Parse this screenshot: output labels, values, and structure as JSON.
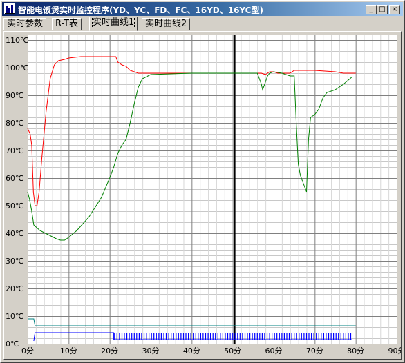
{
  "window": {
    "title": "智能电饭煲实时监控程序(YD、YC、FD、FC、16YD、16YC型)",
    "controls": {
      "minimize": "_",
      "maximize": "□",
      "close": "×"
    }
  },
  "tabs": [
    {
      "label": "实时参数",
      "active": false
    },
    {
      "label": "R-T表",
      "active": false
    },
    {
      "label": "实时曲线1",
      "active": true
    },
    {
      "label": "实时曲线2",
      "active": false
    }
  ],
  "chart_data": {
    "type": "line",
    "xlim": [
      0,
      90
    ],
    "ylim": [
      0,
      112
    ],
    "xticks": [
      0,
      10,
      20,
      30,
      40,
      50,
      60,
      70,
      80,
      90
    ],
    "xtick_labels": [
      "0分",
      "10分",
      "20分",
      "30分",
      "40分",
      "50分",
      "60分",
      "70分",
      "80分",
      "90分"
    ],
    "yticks": [
      0,
      10,
      20,
      30,
      40,
      50,
      60,
      70,
      80,
      90,
      100,
      110
    ],
    "ytick_labels": [
      "0℃",
      "10℃",
      "20℃",
      "30℃",
      "40℃",
      "50℃",
      "60℃",
      "70℃",
      "80℃",
      "90℃",
      "100℃",
      "110℃"
    ],
    "grid": true,
    "colors": {
      "red": "#ff0000",
      "green": "#008000",
      "teal": "#008080",
      "blue": "#0000ff",
      "marker": "#000000"
    },
    "marker_x": 50.5,
    "series": [
      {
        "color": "red",
        "points": [
          [
            0,
            78
          ],
          [
            0.6,
            76
          ],
          [
            1,
            72
          ],
          [
            1.4,
            55
          ],
          [
            1.8,
            50
          ],
          [
            2.3,
            50
          ],
          [
            2.8,
            55
          ],
          [
            3.5,
            68
          ],
          [
            4.5,
            84
          ],
          [
            5.5,
            96
          ],
          [
            6.5,
            101
          ],
          [
            7.5,
            102.5
          ],
          [
            9,
            103
          ],
          [
            10,
            103.5
          ],
          [
            13,
            104
          ],
          [
            18,
            104
          ],
          [
            21.5,
            104
          ],
          [
            22,
            102
          ],
          [
            23,
            101
          ],
          [
            24,
            100.5
          ],
          [
            25,
            99
          ],
          [
            27,
            98
          ],
          [
            30,
            98
          ],
          [
            40,
            98
          ],
          [
            50,
            98
          ],
          [
            57,
            98
          ],
          [
            58,
            97.5
          ],
          [
            59,
            98.5
          ],
          [
            60,
            98.5
          ],
          [
            61,
            98
          ],
          [
            64,
            98
          ],
          [
            65,
            99
          ],
          [
            70,
            99
          ],
          [
            75,
            98.5
          ],
          [
            77,
            98
          ],
          [
            80,
            98
          ]
        ]
      },
      {
        "color": "green",
        "points": [
          [
            0,
            55
          ],
          [
            0.5,
            52
          ],
          [
            1,
            48
          ],
          [
            1.5,
            43
          ],
          [
            3,
            41
          ],
          [
            5,
            39.5
          ],
          [
            7,
            38
          ],
          [
            8,
            37.5
          ],
          [
            9,
            37.5
          ],
          [
            10,
            38.5
          ],
          [
            12,
            41
          ],
          [
            15,
            46
          ],
          [
            18,
            53
          ],
          [
            20,
            60
          ],
          [
            21,
            64
          ],
          [
            22,
            69
          ],
          [
            23,
            72
          ],
          [
            24,
            74
          ],
          [
            25,
            80
          ],
          [
            26,
            87
          ],
          [
            27,
            93
          ],
          [
            28,
            96
          ],
          [
            30,
            97.5
          ],
          [
            40,
            98
          ],
          [
            50,
            98
          ],
          [
            56,
            98
          ],
          [
            57,
            94
          ],
          [
            57.3,
            92
          ],
          [
            57.8,
            94
          ],
          [
            58.5,
            97
          ],
          [
            59,
            98
          ],
          [
            60,
            98.5
          ],
          [
            62,
            98
          ],
          [
            64,
            97
          ],
          [
            65,
            97
          ],
          [
            65.5,
            80
          ],
          [
            66,
            65
          ],
          [
            66.5,
            61
          ],
          [
            67,
            59
          ],
          [
            67.5,
            57
          ],
          [
            68,
            55
          ],
          [
            68.5,
            74
          ],
          [
            69,
            82
          ],
          [
            70,
            83
          ],
          [
            71,
            85
          ],
          [
            72,
            89
          ],
          [
            73,
            91
          ],
          [
            75,
            92
          ],
          [
            77,
            94
          ],
          [
            79,
            96.5
          ]
        ]
      },
      {
        "color": "teal",
        "points": [
          [
            0,
            9
          ],
          [
            1.5,
            9
          ],
          [
            1.8,
            6.5
          ],
          [
            3,
            6.5
          ],
          [
            80,
            6.5
          ]
        ]
      },
      {
        "color": "blue",
        "points": [
          [
            1.5,
            1
          ],
          [
            1.8,
            4
          ],
          [
            21,
            4
          ],
          [
            21,
            1.5
          ],
          [
            79,
            1.5
          ]
        ]
      }
    ]
  }
}
